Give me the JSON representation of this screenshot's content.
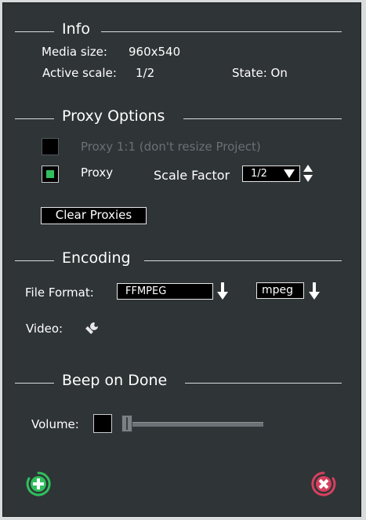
{
  "info": {
    "title": "Info",
    "media_size_label": "Media size:",
    "media_size_value": "960x540",
    "active_scale_label": "Active scale:",
    "active_scale_value": "1/2",
    "state_text": "State: On"
  },
  "proxy": {
    "title": "Proxy Options",
    "proxy_1_1_label": "Proxy 1:1 (don't resize Project)",
    "proxy_1_1_checked": false,
    "proxy_label": "Proxy",
    "proxy_checked": true,
    "scale_factor_label": "Scale Factor",
    "scale_factor_value": "1/2",
    "clear_button": "Clear Proxies"
  },
  "encoding": {
    "title": "Encoding",
    "file_format_label": "File Format:",
    "file_format_value": "FFMPEG",
    "container_value": "mpeg",
    "video_label": "Video:"
  },
  "beep": {
    "title": "Beep on Done",
    "volume_label": "Volume:",
    "volume_level": 0.0
  },
  "colors": {
    "background": "#2f3437",
    "ok": "#2fbf5c",
    "cancel": "#d6405f"
  },
  "icons": [
    "wrench-icon",
    "ok-icon",
    "cancel-icon",
    "arrow-down-icon",
    "spin-updown-icon"
  ]
}
